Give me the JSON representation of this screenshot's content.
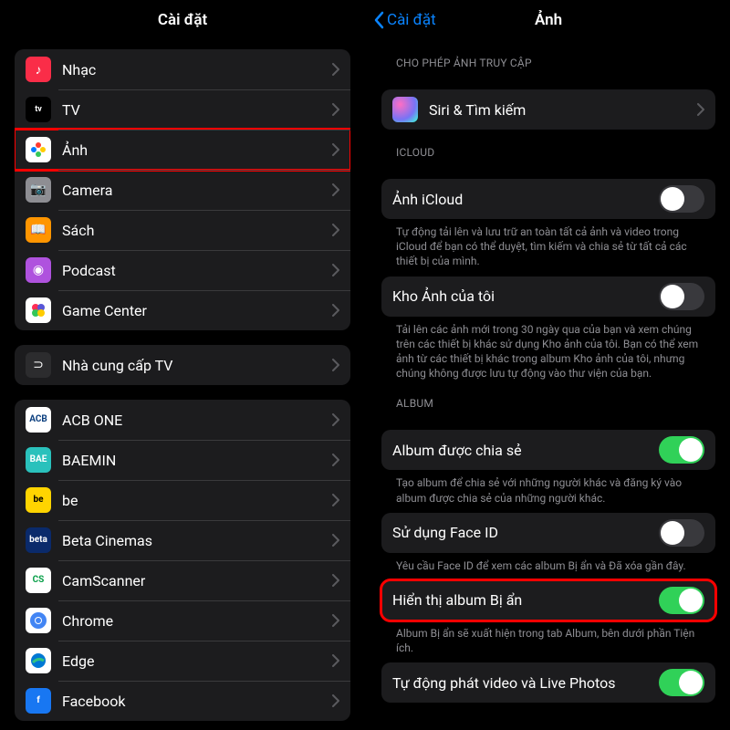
{
  "left": {
    "title": "Cài đặt",
    "group1": [
      {
        "label": "Nhạc",
        "bg": "#fa2d48",
        "icon": "♪"
      },
      {
        "label": "TV",
        "bg": "#000",
        "icon": "tv"
      },
      {
        "label": "Ảnh",
        "bg": "#fff",
        "icon": "photos",
        "highlight": true
      },
      {
        "label": "Camera",
        "bg": "#8e8e93",
        "icon": "📷"
      },
      {
        "label": "Sách",
        "bg": "#ff9500",
        "icon": "📖"
      },
      {
        "label": "Podcast",
        "bg": "#af52de",
        "icon": "◉"
      },
      {
        "label": "Game Center",
        "bg": "#fff",
        "icon": "gc"
      }
    ],
    "group2": [
      {
        "label": "Nhà cung cấp TV",
        "bg": "#2c2c2e",
        "icon": "⊃"
      }
    ],
    "group3": [
      {
        "label": "ACB ONE",
        "bg": "#fff",
        "txt": "ACB",
        "txtcolor": "#0a3e7e"
      },
      {
        "label": "BAEMIN",
        "bg": "#2ac1bc",
        "txt": "BAE"
      },
      {
        "label": "be",
        "bg": "#ffd400",
        "txt": "be",
        "txtcolor": "#000"
      },
      {
        "label": "Beta Cinemas",
        "bg": "#0a2a6b",
        "txt": "beta"
      },
      {
        "label": "CamScanner",
        "bg": "#fff",
        "txt": "CS",
        "txtcolor": "#0aa04a"
      },
      {
        "label": "Chrome",
        "bg": "#fff",
        "icon": "chrome"
      },
      {
        "label": "Edge",
        "bg": "#fff",
        "icon": "edge"
      },
      {
        "label": "Facebook",
        "bg": "#1877f2",
        "txt": "f"
      }
    ]
  },
  "right": {
    "back": "Cài đặt",
    "title": "Ảnh",
    "access_header": "CHO PHÉP ẢNH TRUY CẬP",
    "siri_label": "Siri & Tìm kiếm",
    "icloud_header": "ICLOUD",
    "icloud_photo": "Ảnh iCloud",
    "icloud_photo_footer": "Tự động tải lên và lưu trữ an toàn tất cả ảnh và video trong iCloud để bạn có thể duyệt, tìm kiếm và chia sẻ từ tất cả các thiết bị của mình.",
    "mystream": "Kho Ảnh của tôi",
    "mystream_footer": "Tải lên các ảnh mới trong 30 ngày qua của bạn và xem chúng trên các thiết bị khác sử dụng Kho ảnh của tôi. Bạn có thể xem ảnh từ các thiết bị khác trong album Kho ảnh của tôi, nhưng chúng không được lưu tự động vào thư viện của bạn.",
    "album_header": "ALBUM",
    "shared_album": "Album được chia sẻ",
    "shared_footer": "Tạo album để chia sẻ với những người khác và đăng ký vào album được chia sẻ của những người khác.",
    "faceid": "Sử dụng Face ID",
    "faceid_footer": "Yêu cầu Face ID để xem các album Bị ẩn và Đã xóa gần đây.",
    "hidden": "Hiển thị album Bị ẩn",
    "hidden_footer": "Album Bị ẩn sẽ xuất hiện trong tab Album, bên dưới phần Tiện ích.",
    "autoplay": "Tự động phát video và Live Photos"
  }
}
